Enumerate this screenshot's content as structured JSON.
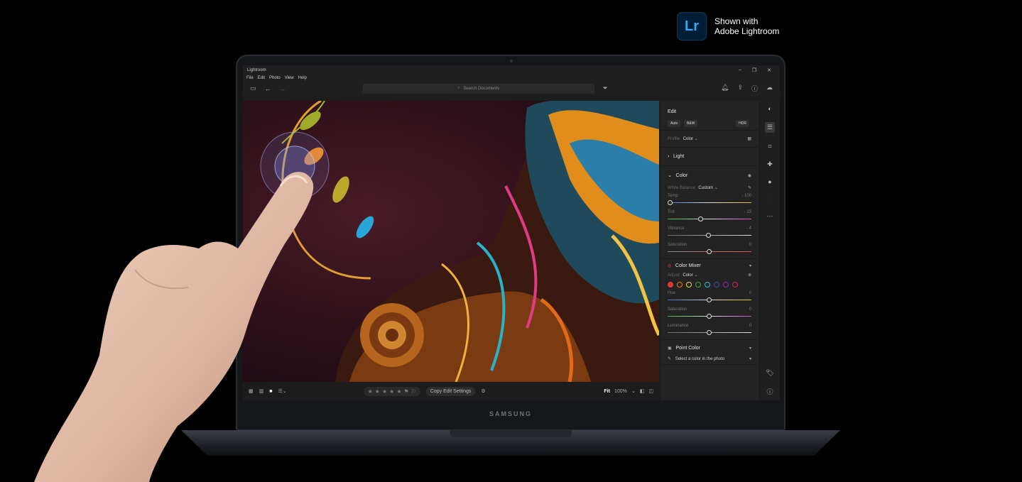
{
  "badge": {
    "logo": "Lr",
    "line1": "Shown with",
    "line2": "Adobe Lightroom"
  },
  "laptop": {
    "brand": "SAMSUNG"
  },
  "app": {
    "title": "Lightroom",
    "menu": [
      "File",
      "Edit",
      "Photo",
      "View",
      "Help"
    ],
    "search_placeholder": "Search Documents"
  },
  "edit_panel": {
    "title": "Edit",
    "buttons": {
      "auto": "Auto",
      "bw": "B&W",
      "hdr": "HDR"
    },
    "profile_label": "Profile",
    "profile_value": "Color",
    "light_label": "Light",
    "color_label": "Color",
    "white_balance_label": "White Balance",
    "white_balance_value": "Custom",
    "sliders": [
      {
        "label": "Temp",
        "value": "- 100",
        "level": 0.03
      },
      {
        "label": "Tint",
        "value": "- 23",
        "level": 0.4
      },
      {
        "label": "Vibrance",
        "value": "- 4",
        "level": 0.49
      },
      {
        "label": "Saturation",
        "value": "0",
        "level": 0.5
      }
    ],
    "color_mixer_label": "Color Mixer",
    "adjust_label": "Adjust",
    "adjust_value": "Color",
    "mixer_colors": [
      "#e53935",
      "#f57c00",
      "#fdd835",
      "#43a047",
      "#26c6da",
      "#3949ab",
      "#8e24aa",
      "#d81b60"
    ],
    "mixer_sliders": [
      {
        "label": "Hue",
        "value": "0",
        "level": 0.5
      },
      {
        "label": "Saturation",
        "value": "0",
        "level": 0.5
      },
      {
        "label": "Luminance",
        "value": "0",
        "level": 0.5
      }
    ],
    "point_color_label": "Point Color",
    "point_color_hint": "Select a color in the photo"
  },
  "bottom_bar": {
    "copy_label": "Copy Edit Settings",
    "fit_label": "Fit",
    "zoom_label": "100%"
  },
  "colors": {
    "accent": "#31a8ff",
    "logo_bg": "#001e36"
  }
}
